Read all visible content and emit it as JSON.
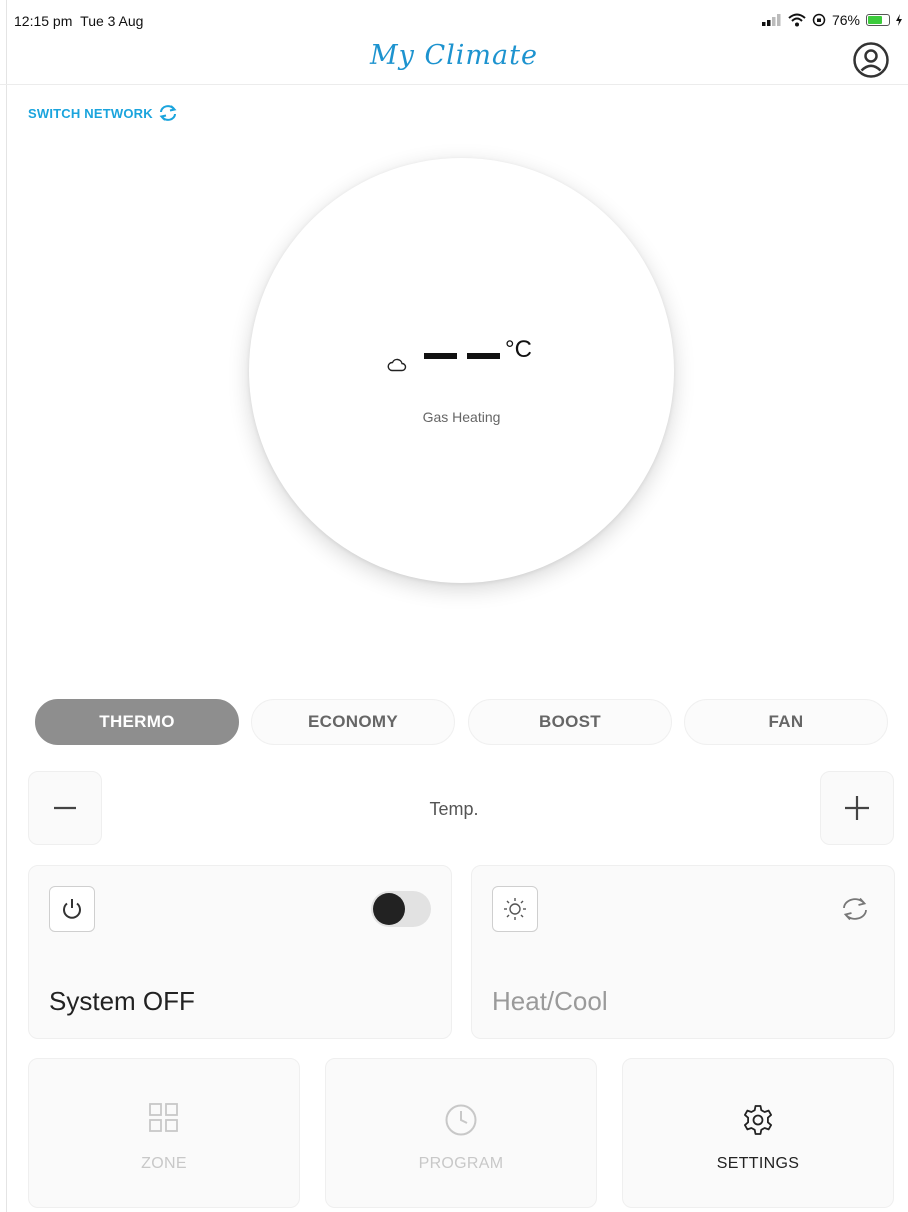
{
  "status_bar": {
    "time": "12:15 pm",
    "date": "Tue 3 Aug",
    "battery_percent": "76%",
    "battery_level": 0.76
  },
  "header": {
    "title": "My Climate",
    "profile_icon": "user-circle-icon"
  },
  "switch_network": {
    "label": "SWITCH NETWORK",
    "icon": "refresh-icon",
    "color": "#1aa4dd"
  },
  "dial": {
    "temperature_placeholder": "— —",
    "unit": "°C",
    "weather_icon": "cloud-icon",
    "label": "Gas Heating"
  },
  "mode_tabs": [
    {
      "label": "THERMO",
      "active": true
    },
    {
      "label": "ECONOMY",
      "active": false
    },
    {
      "label": "BOOST",
      "active": false
    },
    {
      "label": "FAN",
      "active": false
    }
  ],
  "temp_control": {
    "label": "Temp.",
    "decrease_icon": "minus-icon",
    "increase_icon": "plus-icon"
  },
  "system_card": {
    "title": "System OFF",
    "icon": "power-icon",
    "toggle_on": false
  },
  "heat_cool_card": {
    "title": "Heat/Cool",
    "icon": "sun-icon",
    "action_icon": "refresh-icon"
  },
  "nav": [
    {
      "label": "ZONE",
      "icon": "grid-icon",
      "enabled": false
    },
    {
      "label": "PROGRAM",
      "icon": "clock-icon",
      "enabled": false
    },
    {
      "label": "SETTINGS",
      "icon": "gear-icon",
      "enabled": true
    }
  ],
  "colors": {
    "brand": "#1d93cf",
    "active_tab": "#8e8e8e",
    "battery": "#3ccb3c"
  }
}
